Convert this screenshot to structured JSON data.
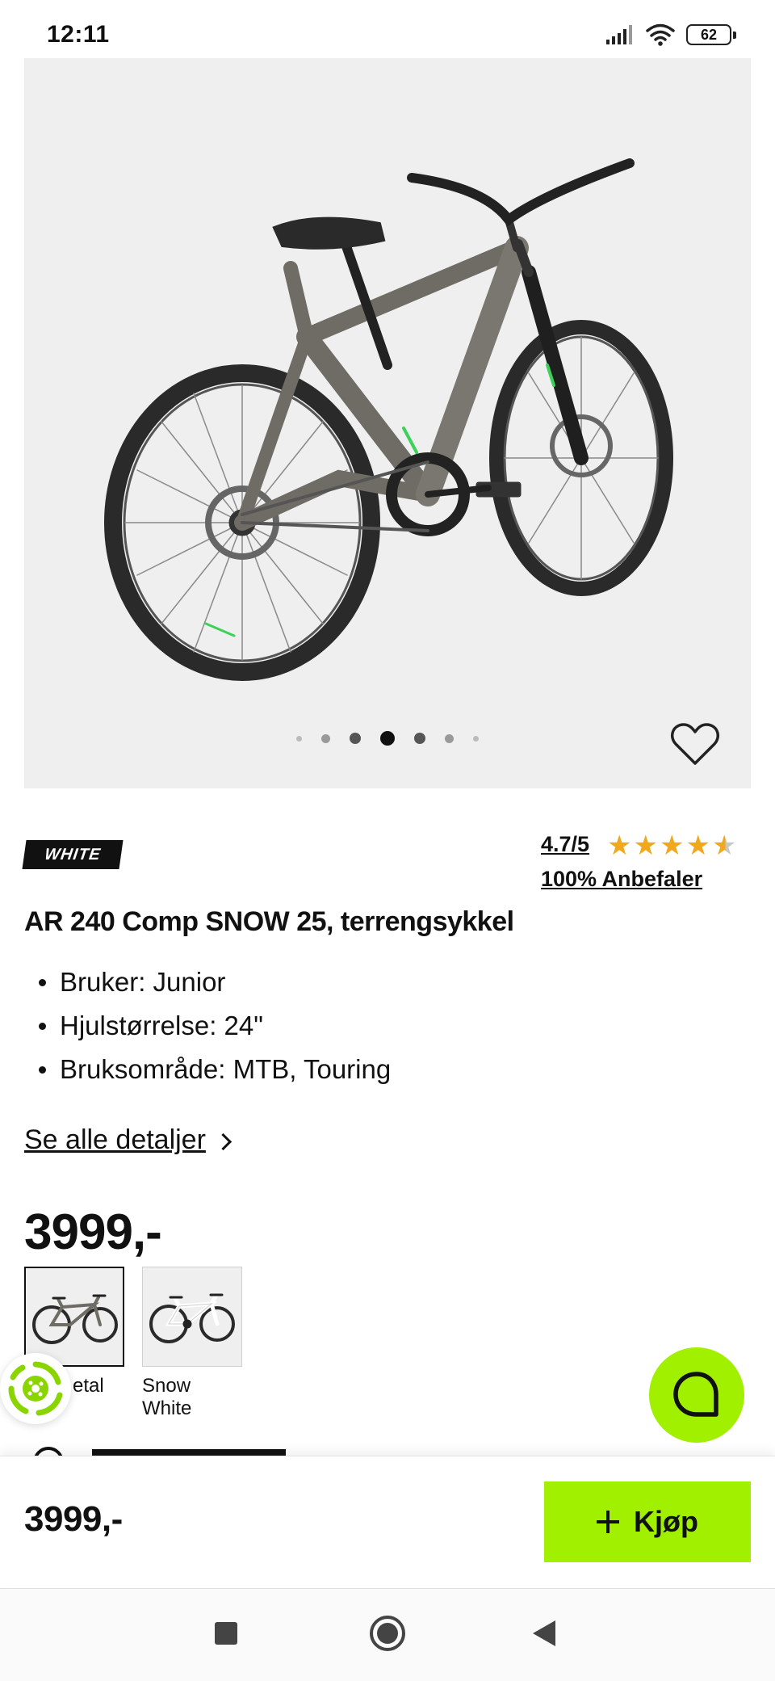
{
  "status_bar": {
    "time": "12:11",
    "battery": "62",
    "icons": [
      "signal-icon",
      "wifi-icon",
      "battery-icon"
    ]
  },
  "gallery": {
    "image": "bike-photo",
    "dots_total": 7,
    "active_dot": 4,
    "favorite_icon": "heart-icon"
  },
  "product": {
    "brand_logo_text": "WHITE",
    "rating": "4.7/5",
    "stars": 4.7,
    "recommend": "100% Anbefaler",
    "title": "AR 240 Comp SNOW 25, terrengsykkel",
    "features": [
      "Bruker: Junior",
      "Hjulstørrelse: 24\"",
      "Bruksområde: MTB, Touring"
    ],
    "details_link": "Se alle detaljer",
    "price": "3999,-"
  },
  "variants": [
    {
      "label_line1": "etal",
      "label_line2": "",
      "selected": true,
      "frame_color": "#6f6c66"
    },
    {
      "label_line1": "Snow",
      "label_line2": "White",
      "selected": false,
      "frame_color": "#f4f4f4"
    }
  ],
  "buy_bar": {
    "price": "3999,-",
    "button_label": "Kjøp"
  },
  "colors": {
    "accent": "#a0f000",
    "star": "#f2a81d",
    "text": "#111111"
  }
}
